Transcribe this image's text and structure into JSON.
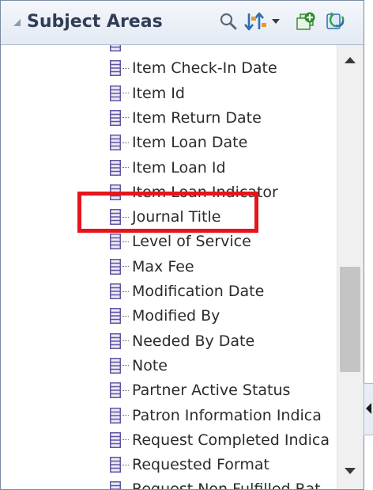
{
  "panel": {
    "title": "Subject Areas",
    "toolbar_icons": [
      "search-icon",
      "sort-icon",
      "sort-dropdown-icon",
      "add-subject-area-icon",
      "refresh-icon"
    ]
  },
  "items": [
    {
      "label": ""
    },
    {
      "label": "Item Check-In Date"
    },
    {
      "label": "Item Id"
    },
    {
      "label": "Item Return Date"
    },
    {
      "label": "Item Loan Date"
    },
    {
      "label": "Item Loan Id"
    },
    {
      "label": "Item Loan Indicator"
    },
    {
      "label": "Journal Title"
    },
    {
      "label": "Level of Service"
    },
    {
      "label": "Max Fee"
    },
    {
      "label": "Modification Date"
    },
    {
      "label": "Modified By"
    },
    {
      "label": "Needed By Date"
    },
    {
      "label": "Note"
    },
    {
      "label": "Partner Active Status"
    },
    {
      "label": "Patron Information Indica"
    },
    {
      "label": "Request Completed Indica"
    },
    {
      "label": "Requested Format"
    },
    {
      "label": "Request Non Fulfilled Rat"
    }
  ],
  "highlighted_item": "Journal Title",
  "colors": {
    "highlight_border": "#e8141a",
    "header_text": "#2f3e57",
    "icon_purple": "#6b5fa6"
  }
}
